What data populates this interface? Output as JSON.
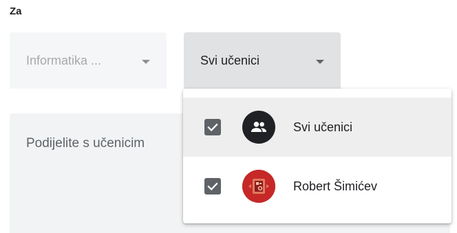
{
  "header": {
    "for_label": "Za"
  },
  "class_select": {
    "value": "Informatika ...",
    "icon": "chevron-down-icon"
  },
  "students_select": {
    "value": "Svi učenici",
    "icon": "chevron-down-icon"
  },
  "instructions": {
    "placeholder": "Podijelite s učenicim"
  },
  "dropdown": {
    "options": [
      {
        "label": "Svi učenici",
        "checked": true,
        "avatar": "group-icon"
      },
      {
        "label": "Robert Šimićev",
        "checked": true,
        "avatar": "user-avatar"
      }
    ]
  },
  "colors": {
    "checkbox": "#5f6368",
    "selected_row": "#eeeeee",
    "avatar_red": "#c62828"
  }
}
